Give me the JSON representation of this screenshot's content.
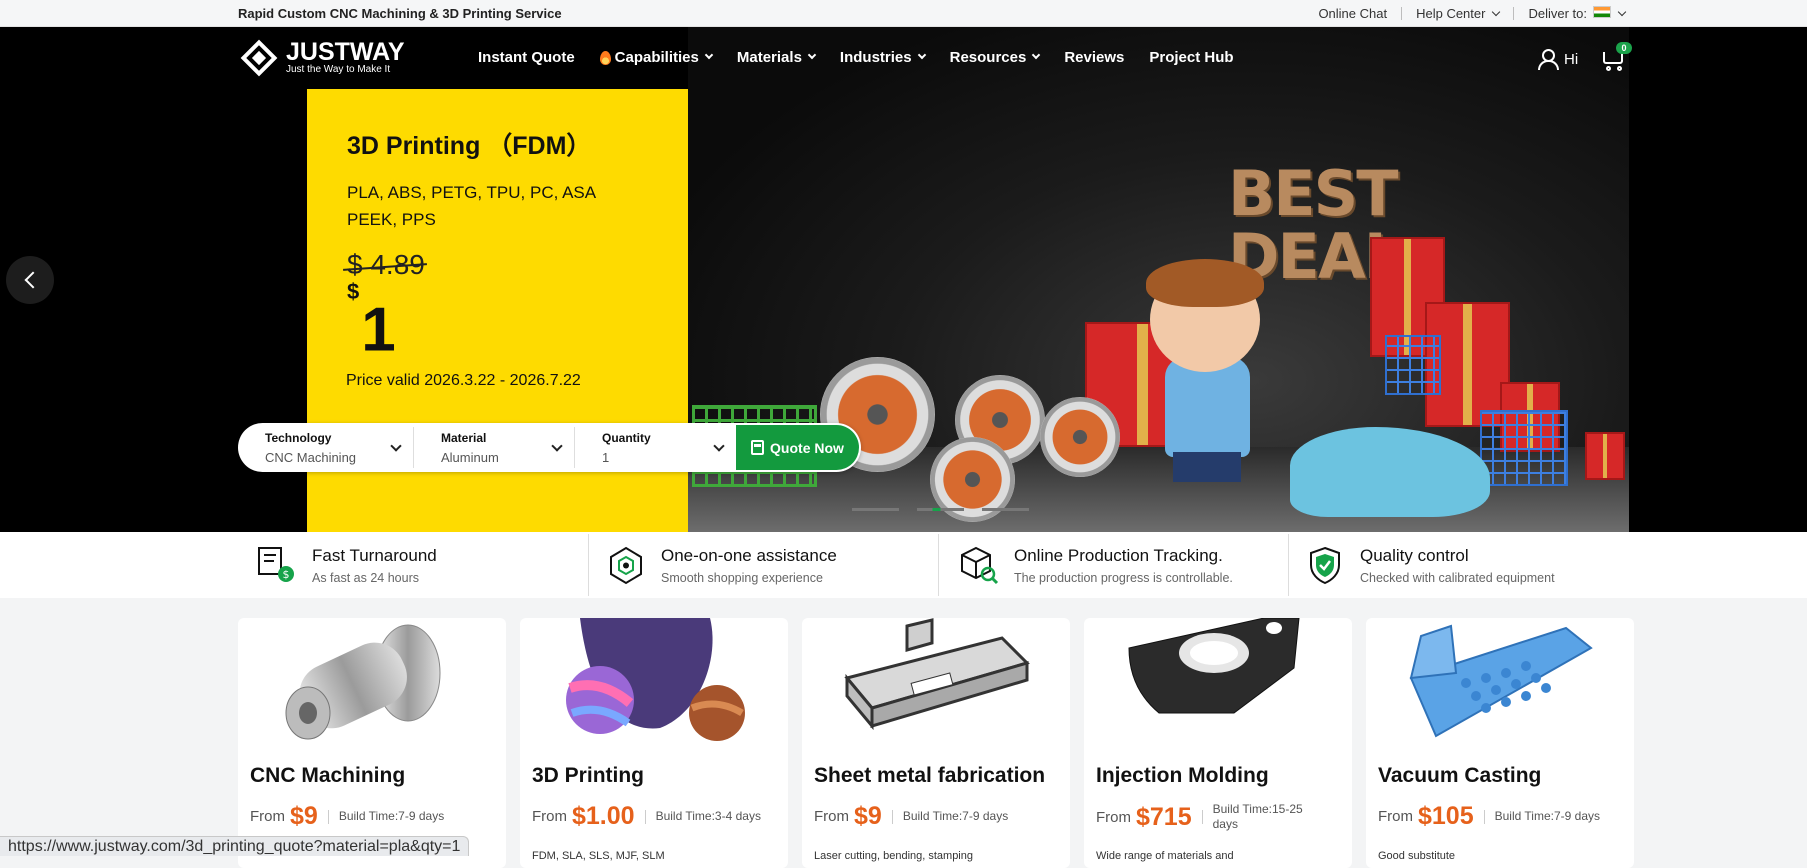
{
  "topbar": {
    "tagline": "Rapid Custom CNC Machining & 3D Printing Service",
    "online_chat": "Online Chat",
    "help_center": "Help Center",
    "deliver_to": "Deliver to:"
  },
  "nav": {
    "brand": "JUSTWAY",
    "slogan": "Just the Way to Make It",
    "items": [
      {
        "label": "Instant Quote"
      },
      {
        "label": "Capabilities"
      },
      {
        "label": "Materials"
      },
      {
        "label": "Industries"
      },
      {
        "label": "Resources"
      },
      {
        "label": "Reviews"
      },
      {
        "label": "Project Hub"
      }
    ],
    "greeting": "Hi",
    "cart_count": "0"
  },
  "promo": {
    "title": "3D Printing （FDM）",
    "materials_line1": "PLA, ABS, PETG, TPU, PC, ASA",
    "materials_line2": "PEEK, PPS",
    "old_price": "$ 4.89",
    "currency": "$",
    "new_price": "1",
    "validity": "Price valid 2026.3.22 - 2026.7.22"
  },
  "hero_art": {
    "best": "BEST",
    "deal": "DEAL"
  },
  "quote": {
    "technology_label": "Technology",
    "technology_value": "CNC Machining",
    "material_label": "Material",
    "material_value": "Aluminum",
    "quantity_label": "Quantity",
    "quantity_value": "1",
    "button": "Quote Now"
  },
  "features": [
    {
      "title": "Fast Turnaround",
      "sub": "As fast as 24 hours",
      "icon": "turnaround-icon"
    },
    {
      "title": "One-on-one assistance",
      "sub": "Smooth shopping experience",
      "icon": "assistance-icon"
    },
    {
      "title": "Online Production Tracking.",
      "sub": "The production progress is controllable.",
      "icon": "tracking-icon"
    },
    {
      "title": "Quality control",
      "sub": "Checked with calibrated equipment",
      "icon": "shield-check-icon"
    }
  ],
  "cards": [
    {
      "name": "CNC Machining",
      "from": "From",
      "price": "$9",
      "build": "Build Time:7-9 days",
      "desc": ""
    },
    {
      "name": "3D Printing",
      "from": "From",
      "price": "$1.00",
      "build": "Build Time:3-4 days",
      "desc": "FDM, SLA, SLS, MJF, SLM"
    },
    {
      "name": "Sheet metal fabrication",
      "from": "From",
      "price": "$9",
      "build": "Build Time:7-9 days",
      "desc": "Laser cutting, bending, stamping"
    },
    {
      "name": "Injection Molding",
      "from": "From",
      "price": "$715",
      "build": "Build Time:15-25 days",
      "desc": "Wide range of materials and"
    },
    {
      "name": "Vacuum Casting",
      "from": "From",
      "price": "$105",
      "build": "Build Time:7-9 days",
      "desc": "Good substitute"
    }
  ],
  "status_url": "https://www.justway.com/3d_printing_quote?material=pla&qty=1",
  "colors": {
    "accent_green": "#139a3e",
    "price_orange": "#e6611b",
    "promo_yellow": "#fedb00"
  }
}
